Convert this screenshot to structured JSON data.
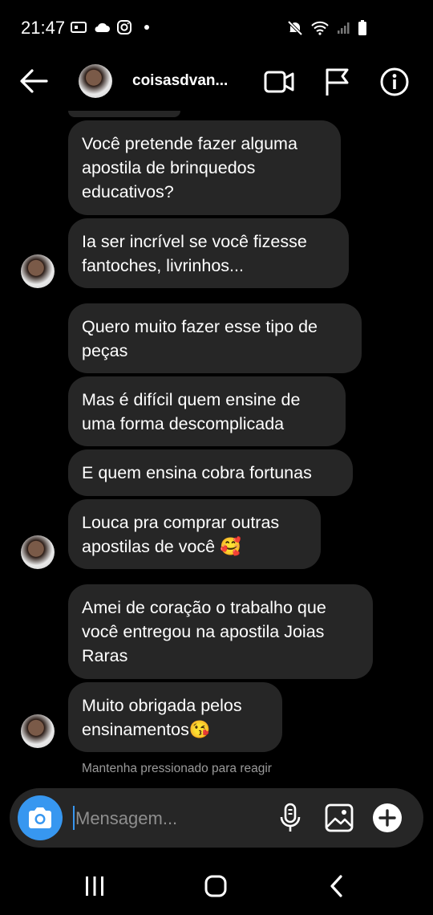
{
  "status_bar": {
    "time": "21:47"
  },
  "header": {
    "username": "coisasdvan..."
  },
  "messages": [
    {
      "text": "Você pretende fazer alguma\napostila de brinquedos\neducativos?"
    },
    {
      "text": "Ia ser incrível se você fizesse\nfantoches, livrinhos..."
    },
    {
      "text": "Quero muito fazer esse tipo de\npeças"
    },
    {
      "text": "Mas é difícil quem ensine de\numa forma descomplicada"
    },
    {
      "text": "E quem ensina cobra fortunas"
    },
    {
      "text": "Louca pra comprar outras\napostilas de você 🥰"
    },
    {
      "text": "Amei de coração o trabalho que\nvocê entregou na apostila Joias\nRaras"
    },
    {
      "text": "Muito obrigada pelos\nensinamentos😘"
    }
  ],
  "hint": "Mantenha pressionado para reagir",
  "composer": {
    "placeholder": "Mensagem..."
  },
  "colors": {
    "background": "#000000",
    "bubble": "#262626",
    "accent": "#3797f0"
  }
}
